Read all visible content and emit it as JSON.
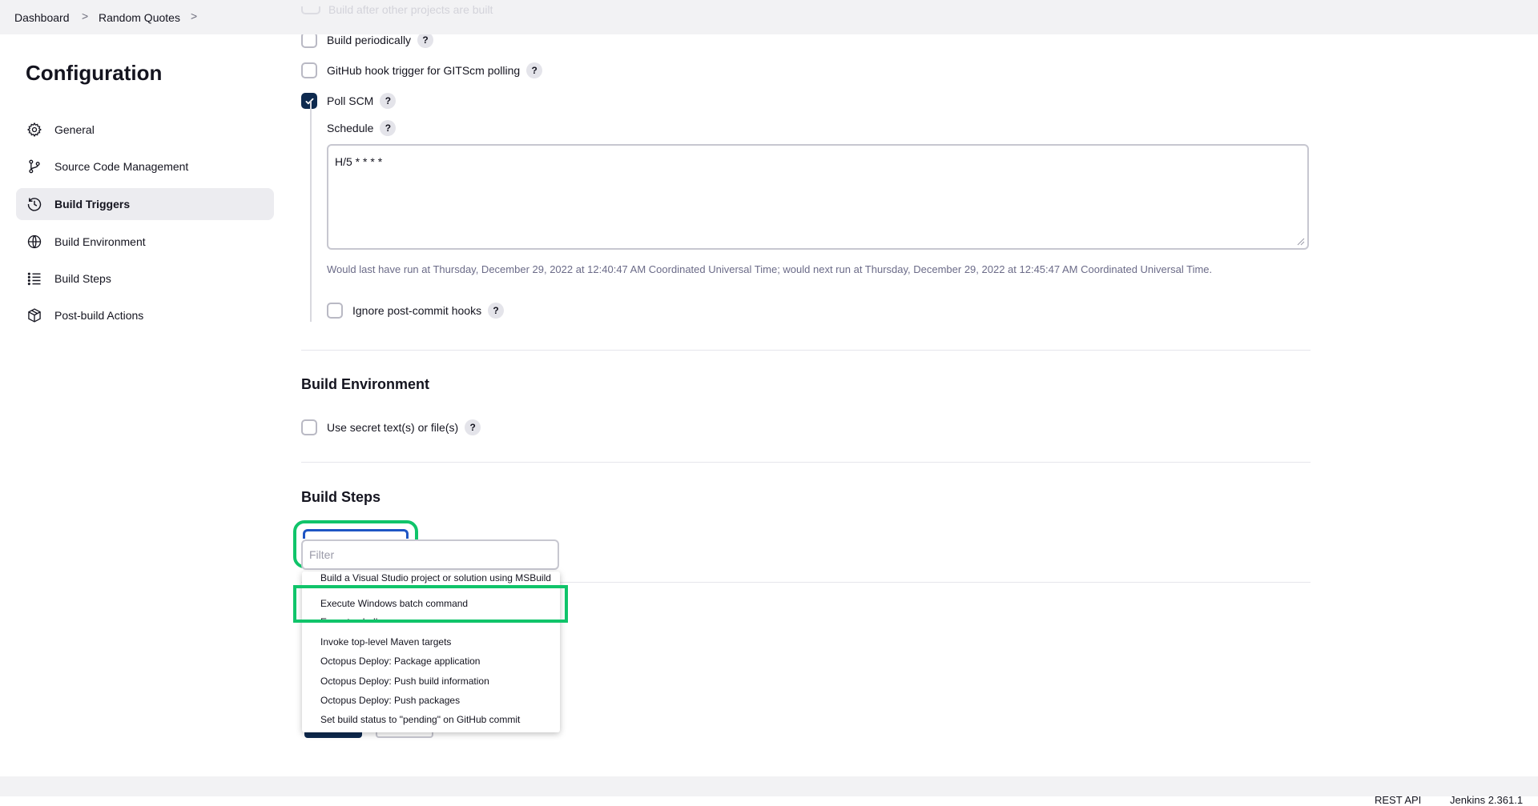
{
  "breadcrumb": {
    "items": [
      "Dashboard",
      "Random Quotes"
    ],
    "separator": ">"
  },
  "faded_row_label": "Build after other projects are built",
  "sidebar": {
    "title": "Configuration",
    "items": [
      {
        "label": "General",
        "icon": "gear-icon"
      },
      {
        "label": "Source Code Management",
        "icon": "branch-icon"
      },
      {
        "label": "Build Triggers",
        "icon": "clock-icon",
        "active": true
      },
      {
        "label": "Build Environment",
        "icon": "globe-icon"
      },
      {
        "label": "Build Steps",
        "icon": "list-icon"
      },
      {
        "label": "Post-build Actions",
        "icon": "package-icon"
      }
    ]
  },
  "triggers": {
    "build_periodically": "Build periodically",
    "github_hook": "GitHub hook trigger for GITScm polling",
    "poll_scm": "Poll SCM",
    "schedule_label": "Schedule",
    "schedule_value": "H/5 * * * *",
    "schedule_note": "Would last have run at Thursday, December 29, 2022 at 12:40:47 AM Coordinated Universal Time; would next run at Thursday, December 29, 2022 at 12:45:47 AM Coordinated Universal Time.",
    "ignore_hooks": "Ignore post-commit hooks"
  },
  "build_environment": {
    "title": "Build Environment",
    "use_secret": "Use secret text(s) or file(s)"
  },
  "build_steps": {
    "title": "Build Steps",
    "filter_placeholder": "Filter",
    "options": [
      "Build a Visual Studio project or solution using MSBuild",
      "Execute Windows batch command",
      "Execute shell",
      "Invoke top-level Maven targets",
      "Octopus Deploy: Package application",
      "Octopus Deploy: Push build information",
      "Octopus Deploy: Push packages",
      "Set build status to \"pending\" on GitHub commit"
    ]
  },
  "help_symbol": "?",
  "footer": {
    "rest_api": "REST API",
    "version": "Jenkins 2.361.1"
  },
  "colors": {
    "accent_green": "#10c46a",
    "checkbox_checked": "#0e2a4f",
    "focus_blue": "#1e55c4"
  }
}
